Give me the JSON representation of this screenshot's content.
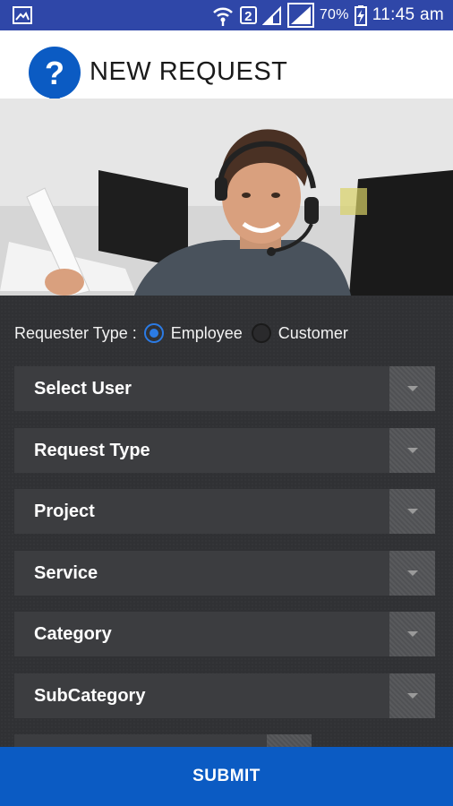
{
  "status_bar": {
    "sim_badge": "2",
    "battery_percent": "70%",
    "time": "11:45 am",
    "icons": [
      "image-notification-icon",
      "wifi-icon",
      "sim-badge-icon",
      "signal-icon",
      "signal-icon",
      "battery-charging-icon"
    ]
  },
  "header": {
    "title": "NEW REQUEST",
    "logo_icon": "question-mark-logo-icon"
  },
  "hero": {
    "description_icon": "support-agent-photo"
  },
  "form": {
    "requester_type": {
      "label": "Requester Type :",
      "options": [
        "Employee",
        "Customer"
      ],
      "selected": "Employee"
    },
    "dropdowns": [
      {
        "label": "Select User"
      },
      {
        "label": "Request Type"
      },
      {
        "label": "Project"
      },
      {
        "label": "Service"
      },
      {
        "label": "Category"
      },
      {
        "label": "SubCategory"
      }
    ]
  },
  "submit": {
    "label": "SUBMIT"
  },
  "colors": {
    "status_bar": "#2f47a8",
    "accent_blue": "#0b5bc3",
    "radio_selected": "#2b7be5",
    "form_background": "#303134",
    "dropdown_background": "#3c3d40"
  }
}
